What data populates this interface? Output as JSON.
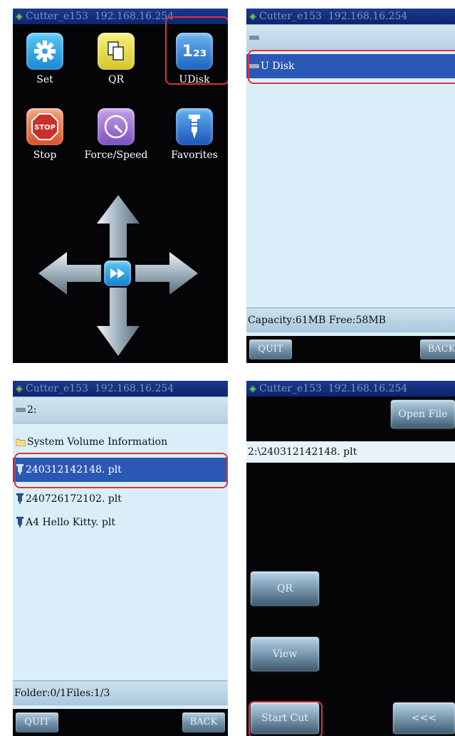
{
  "status_bar": {
    "device": "Cutter_e153",
    "ip": "192.168.16.254"
  },
  "home": {
    "apps": [
      {
        "label": "Set"
      },
      {
        "label": "QR"
      },
      {
        "label": "UDisk"
      },
      {
        "label": "Stop"
      },
      {
        "label": "Force/Speed"
      },
      {
        "label": "Favorites"
      }
    ],
    "udisk_icon_text": "1₂₃",
    "stop_icon_text": "STOP"
  },
  "disk_browser": {
    "items": [
      {
        "label": ""
      },
      {
        "label": "U Disk"
      }
    ],
    "capacity_text": "Capacity:61MB Free:58MB",
    "quit_label": "QUIT",
    "back_label": "BACK"
  },
  "file_browser": {
    "path": "2:",
    "folder": "System Volume Information",
    "files": [
      {
        "label": "240312142148. plt"
      },
      {
        "label": "240726172102. plt"
      },
      {
        "label": "A4 Hello Kitty. plt"
      }
    ],
    "summary_text": "Folder:0/1Files:1/3",
    "quit_label": "QUIT",
    "back_label": "BACK"
  },
  "cut_screen": {
    "open_file_label": "Open File",
    "file_path": "2:\\240312142148. plt",
    "qr_label": "QR",
    "view_label": "View",
    "start_cut_label": "Start Cut",
    "prev_label": "<<<"
  },
  "colors": {
    "highlight": "#e0303a",
    "selected_row": "#2b57b5",
    "status_bar": "#1a3a8a"
  }
}
